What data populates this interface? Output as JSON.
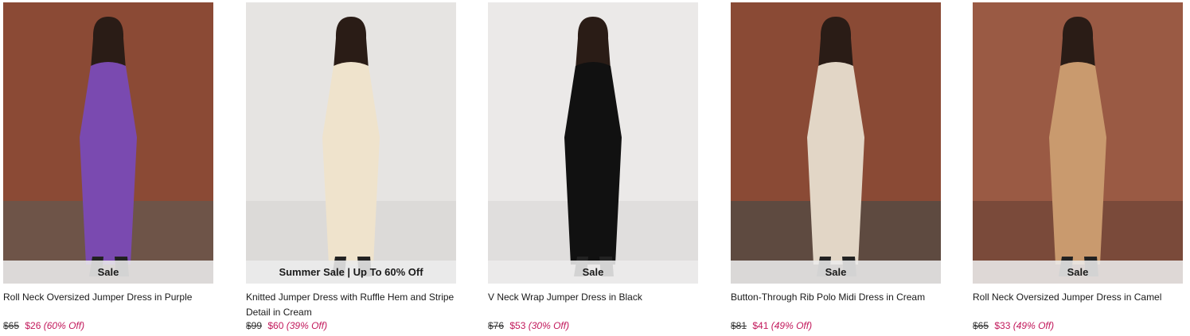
{
  "products": [
    {
      "badge": "Sale",
      "name": "Roll Neck Oversized Jumper Dress in Purple",
      "was": "$65",
      "now": "$26",
      "off": "(60% Off)",
      "bg": "#8b4a35",
      "dress": "#7a4ab0",
      "floor": "#6e5448"
    },
    {
      "badge": "Summer Sale | Up To 60% Off",
      "name": "Knitted Jumper Dress with Ruffle Hem and Stripe Detail in Cream",
      "was": "$99",
      "now": "$60",
      "off": "(39% Off)",
      "bg": "#e6e4e2",
      "dress": "#efe3cc",
      "floor": "#dcdad8"
    },
    {
      "badge": "Sale",
      "name": "V Neck Wrap Jumper Dress in Black",
      "was": "$76",
      "now": "$53",
      "off": "(30% Off)",
      "bg": "#ebe9e8",
      "dress": "#111111",
      "floor": "#e0dedd"
    },
    {
      "badge": "Sale",
      "name": "Button-Through Rib Polo Midi Dress in Cream",
      "was": "$81",
      "now": "$41",
      "off": "(49% Off)",
      "bg": "#8a4a35",
      "dress": "#e2d6c6",
      "floor": "#5e4a40"
    },
    {
      "badge": "Sale",
      "name": "Roll Neck Oversized Jumper Dress in Camel",
      "was": "$65",
      "now": "$33",
      "off": "(49% Off)",
      "bg": "#9a5a44",
      "dress": "#c99a6e",
      "floor": "#7a4a3a"
    }
  ]
}
